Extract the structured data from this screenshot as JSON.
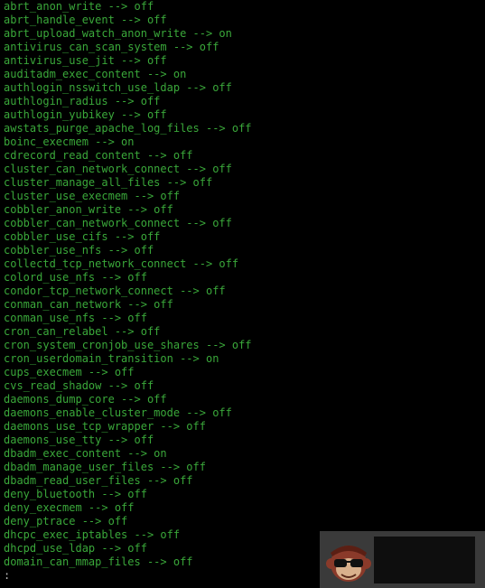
{
  "terminal": {
    "lines": [
      "abrt_anon_write --> off",
      "abrt_handle_event --> off",
      "abrt_upload_watch_anon_write --> on",
      "antivirus_can_scan_system --> off",
      "antivirus_use_jit --> off",
      "auditadm_exec_content --> on",
      "authlogin_nsswitch_use_ldap --> off",
      "authlogin_radius --> off",
      "authlogin_yubikey --> off",
      "awstats_purge_apache_log_files --> off",
      "boinc_execmem --> on",
      "cdrecord_read_content --> off",
      "cluster_can_network_connect --> off",
      "cluster_manage_all_files --> off",
      "cluster_use_execmem --> off",
      "cobbler_anon_write --> off",
      "cobbler_can_network_connect --> off",
      "cobbler_use_cifs --> off",
      "cobbler_use_nfs --> off",
      "collectd_tcp_network_connect --> off",
      "colord_use_nfs --> off",
      "condor_tcp_network_connect --> off",
      "conman_can_network --> off",
      "conman_use_nfs --> off",
      "cron_can_relabel --> off",
      "cron_system_cronjob_use_shares --> off",
      "cron_userdomain_transition --> on",
      "cups_execmem --> off",
      "cvs_read_shadow --> off",
      "daemons_dump_core --> off",
      "daemons_enable_cluster_mode --> off",
      "daemons_use_tcp_wrapper --> off",
      "daemons_use_tty --> off",
      "dbadm_exec_content --> on",
      "dbadm_manage_user_files --> off",
      "dbadm_read_user_files --> off",
      "deny_bluetooth --> off",
      "deny_execmem --> off",
      "deny_ptrace --> off",
      "dhcpc_exec_iptables --> off",
      "dhcpd_use_ldap --> off",
      "domain_can_mmap_files --> off"
    ],
    "prompt": ":"
  },
  "colors": {
    "background": "#000000",
    "text": "#3aa83a",
    "prompt": "#b8b8b8"
  },
  "overlay": {
    "icon": "monkey-sunglasses-icon"
  }
}
